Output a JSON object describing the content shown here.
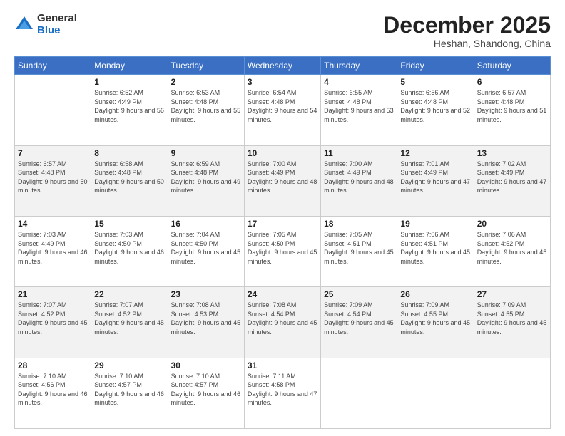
{
  "header": {
    "logo_general": "General",
    "logo_blue": "Blue",
    "month_title": "December 2025",
    "location": "Heshan, Shandong, China"
  },
  "weekdays": [
    "Sunday",
    "Monday",
    "Tuesday",
    "Wednesday",
    "Thursday",
    "Friday",
    "Saturday"
  ],
  "weeks": [
    [
      {
        "day": "",
        "sunrise": "",
        "sunset": "",
        "daylight": ""
      },
      {
        "day": "1",
        "sunrise": "Sunrise: 6:52 AM",
        "sunset": "Sunset: 4:49 PM",
        "daylight": "Daylight: 9 hours and 56 minutes."
      },
      {
        "day": "2",
        "sunrise": "Sunrise: 6:53 AM",
        "sunset": "Sunset: 4:48 PM",
        "daylight": "Daylight: 9 hours and 55 minutes."
      },
      {
        "day": "3",
        "sunrise": "Sunrise: 6:54 AM",
        "sunset": "Sunset: 4:48 PM",
        "daylight": "Daylight: 9 hours and 54 minutes."
      },
      {
        "day": "4",
        "sunrise": "Sunrise: 6:55 AM",
        "sunset": "Sunset: 4:48 PM",
        "daylight": "Daylight: 9 hours and 53 minutes."
      },
      {
        "day": "5",
        "sunrise": "Sunrise: 6:56 AM",
        "sunset": "Sunset: 4:48 PM",
        "daylight": "Daylight: 9 hours and 52 minutes."
      },
      {
        "day": "6",
        "sunrise": "Sunrise: 6:57 AM",
        "sunset": "Sunset: 4:48 PM",
        "daylight": "Daylight: 9 hours and 51 minutes."
      }
    ],
    [
      {
        "day": "7",
        "sunrise": "Sunrise: 6:57 AM",
        "sunset": "Sunset: 4:48 PM",
        "daylight": "Daylight: 9 hours and 50 minutes."
      },
      {
        "day": "8",
        "sunrise": "Sunrise: 6:58 AM",
        "sunset": "Sunset: 4:48 PM",
        "daylight": "Daylight: 9 hours and 50 minutes."
      },
      {
        "day": "9",
        "sunrise": "Sunrise: 6:59 AM",
        "sunset": "Sunset: 4:48 PM",
        "daylight": "Daylight: 9 hours and 49 minutes."
      },
      {
        "day": "10",
        "sunrise": "Sunrise: 7:00 AM",
        "sunset": "Sunset: 4:49 PM",
        "daylight": "Daylight: 9 hours and 48 minutes."
      },
      {
        "day": "11",
        "sunrise": "Sunrise: 7:00 AM",
        "sunset": "Sunset: 4:49 PM",
        "daylight": "Daylight: 9 hours and 48 minutes."
      },
      {
        "day": "12",
        "sunrise": "Sunrise: 7:01 AM",
        "sunset": "Sunset: 4:49 PM",
        "daylight": "Daylight: 9 hours and 47 minutes."
      },
      {
        "day": "13",
        "sunrise": "Sunrise: 7:02 AM",
        "sunset": "Sunset: 4:49 PM",
        "daylight": "Daylight: 9 hours and 47 minutes."
      }
    ],
    [
      {
        "day": "14",
        "sunrise": "Sunrise: 7:03 AM",
        "sunset": "Sunset: 4:49 PM",
        "daylight": "Daylight: 9 hours and 46 minutes."
      },
      {
        "day": "15",
        "sunrise": "Sunrise: 7:03 AM",
        "sunset": "Sunset: 4:50 PM",
        "daylight": "Daylight: 9 hours and 46 minutes."
      },
      {
        "day": "16",
        "sunrise": "Sunrise: 7:04 AM",
        "sunset": "Sunset: 4:50 PM",
        "daylight": "Daylight: 9 hours and 45 minutes."
      },
      {
        "day": "17",
        "sunrise": "Sunrise: 7:05 AM",
        "sunset": "Sunset: 4:50 PM",
        "daylight": "Daylight: 9 hours and 45 minutes."
      },
      {
        "day": "18",
        "sunrise": "Sunrise: 7:05 AM",
        "sunset": "Sunset: 4:51 PM",
        "daylight": "Daylight: 9 hours and 45 minutes."
      },
      {
        "day": "19",
        "sunrise": "Sunrise: 7:06 AM",
        "sunset": "Sunset: 4:51 PM",
        "daylight": "Daylight: 9 hours and 45 minutes."
      },
      {
        "day": "20",
        "sunrise": "Sunrise: 7:06 AM",
        "sunset": "Sunset: 4:52 PM",
        "daylight": "Daylight: 9 hours and 45 minutes."
      }
    ],
    [
      {
        "day": "21",
        "sunrise": "Sunrise: 7:07 AM",
        "sunset": "Sunset: 4:52 PM",
        "daylight": "Daylight: 9 hours and 45 minutes."
      },
      {
        "day": "22",
        "sunrise": "Sunrise: 7:07 AM",
        "sunset": "Sunset: 4:52 PM",
        "daylight": "Daylight: 9 hours and 45 minutes."
      },
      {
        "day": "23",
        "sunrise": "Sunrise: 7:08 AM",
        "sunset": "Sunset: 4:53 PM",
        "daylight": "Daylight: 9 hours and 45 minutes."
      },
      {
        "day": "24",
        "sunrise": "Sunrise: 7:08 AM",
        "sunset": "Sunset: 4:54 PM",
        "daylight": "Daylight: 9 hours and 45 minutes."
      },
      {
        "day": "25",
        "sunrise": "Sunrise: 7:09 AM",
        "sunset": "Sunset: 4:54 PM",
        "daylight": "Daylight: 9 hours and 45 minutes."
      },
      {
        "day": "26",
        "sunrise": "Sunrise: 7:09 AM",
        "sunset": "Sunset: 4:55 PM",
        "daylight": "Daylight: 9 hours and 45 minutes."
      },
      {
        "day": "27",
        "sunrise": "Sunrise: 7:09 AM",
        "sunset": "Sunset: 4:55 PM",
        "daylight": "Daylight: 9 hours and 45 minutes."
      }
    ],
    [
      {
        "day": "28",
        "sunrise": "Sunrise: 7:10 AM",
        "sunset": "Sunset: 4:56 PM",
        "daylight": "Daylight: 9 hours and 46 minutes."
      },
      {
        "day": "29",
        "sunrise": "Sunrise: 7:10 AM",
        "sunset": "Sunset: 4:57 PM",
        "daylight": "Daylight: 9 hours and 46 minutes."
      },
      {
        "day": "30",
        "sunrise": "Sunrise: 7:10 AM",
        "sunset": "Sunset: 4:57 PM",
        "daylight": "Daylight: 9 hours and 46 minutes."
      },
      {
        "day": "31",
        "sunrise": "Sunrise: 7:11 AM",
        "sunset": "Sunset: 4:58 PM",
        "daylight": "Daylight: 9 hours and 47 minutes."
      },
      {
        "day": "",
        "sunrise": "",
        "sunset": "",
        "daylight": ""
      },
      {
        "day": "",
        "sunrise": "",
        "sunset": "",
        "daylight": ""
      },
      {
        "day": "",
        "sunrise": "",
        "sunset": "",
        "daylight": ""
      }
    ]
  ]
}
